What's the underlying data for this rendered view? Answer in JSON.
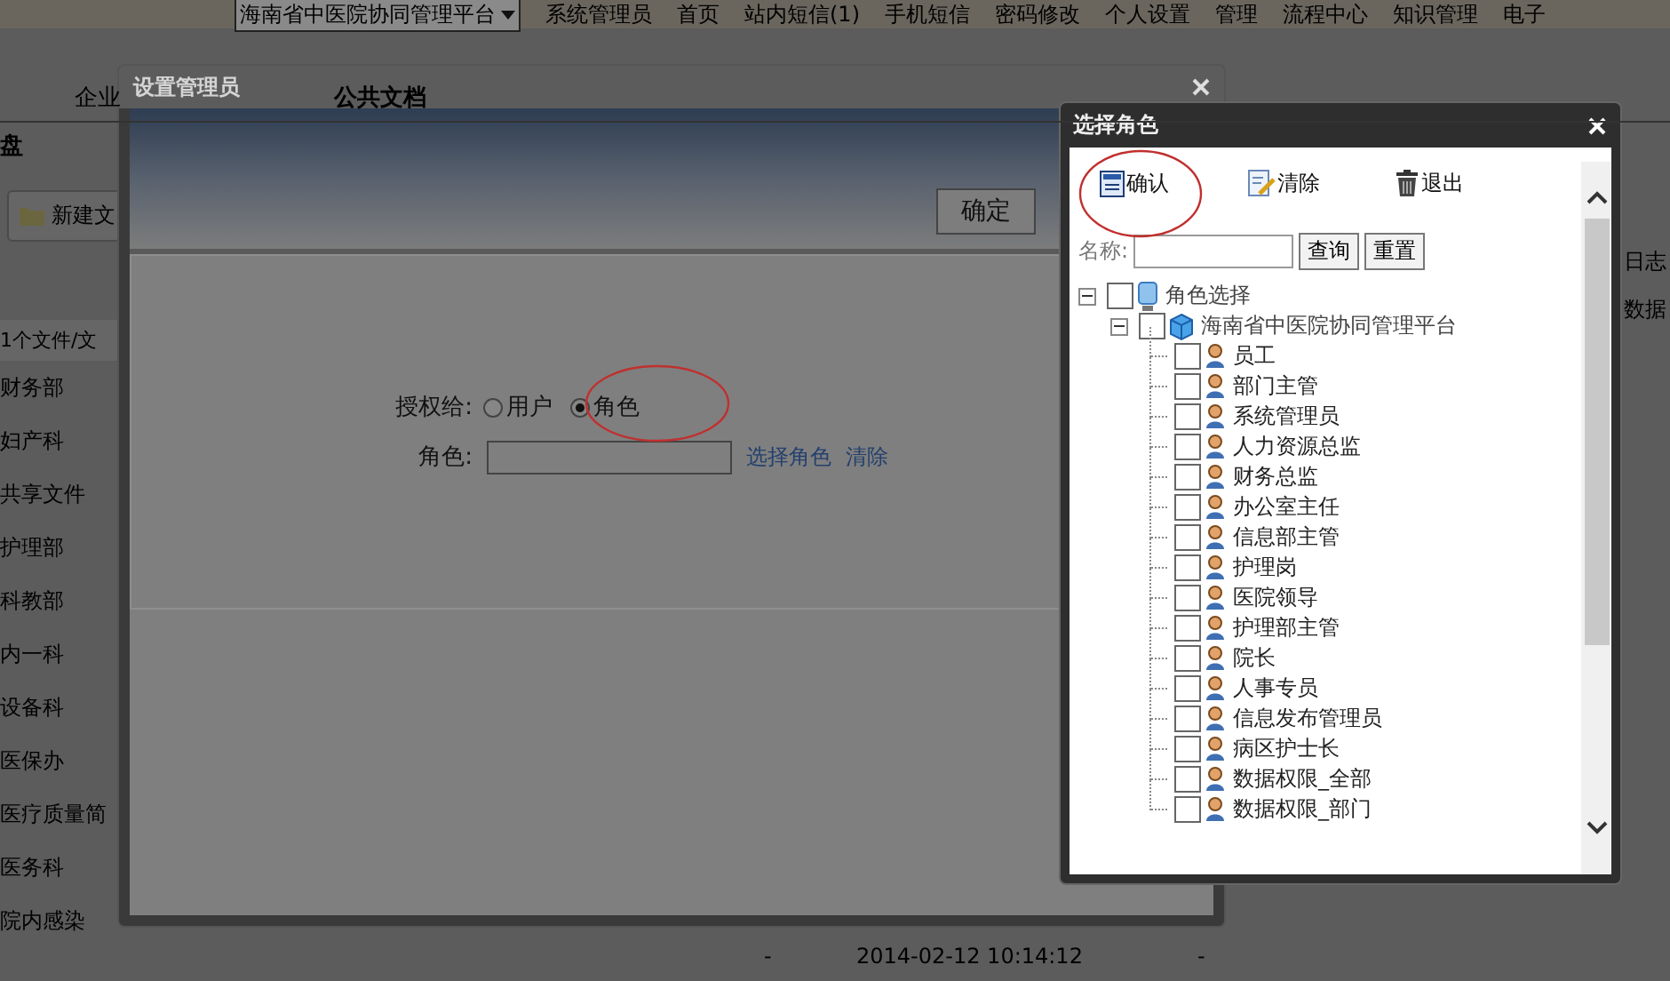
{
  "top_nav": {
    "org_select": "海南省中医院协同管理平台",
    "links": [
      "系统管理员",
      "首页",
      "站内短信(1)",
      "手机短信",
      "密码修改",
      "个人设置",
      "管理",
      "流程中心",
      "知识管理",
      "电子"
    ]
  },
  "tabs": [
    "企业",
    "公共文档"
  ],
  "left_panel": {
    "title": "盘",
    "new_button": "新建文",
    "count_text": "1个文件/文",
    "folders": [
      "财务部",
      "妇产科",
      "共享文件",
      "护理部",
      "科教部",
      "内一科",
      "设备科",
      "医保办",
      "医疗质量简",
      "医务科",
      "院内感染"
    ]
  },
  "right_column": [
    "日志",
    "数据"
  ],
  "bottom_row": [
    "-",
    "2014-02-12 10:14:12",
    "-"
  ],
  "admin_dialog": {
    "title": "设置管理员",
    "confirm_button": "确定",
    "grant_label": "授权给:",
    "grant_options": [
      {
        "label": "用户",
        "selected": false
      },
      {
        "label": "角色",
        "selected": true
      }
    ],
    "role_label": "角色:",
    "select_link": "选择角色",
    "clear_link": "清除"
  },
  "role_dialog": {
    "title": "选择角色",
    "toolbar": [
      {
        "kind": "confirm",
        "label": "确认"
      },
      {
        "kind": "clear",
        "label": "清除"
      },
      {
        "kind": "exit",
        "label": "退出"
      }
    ],
    "search_label": "名称:",
    "search_button": "查询",
    "reset_button": "重置",
    "tree": [
      {
        "label": "角色选择",
        "kind": "root",
        "expanded": true,
        "checked": false,
        "children": [
          {
            "label": "海南省中医院协同管理平台",
            "kind": "org",
            "expanded": true,
            "checked": false,
            "children": [
              {
                "label": "员工",
                "kind": "role",
                "checked": false
              },
              {
                "label": "部门主管",
                "kind": "role",
                "checked": false
              },
              {
                "label": "系统管理员",
                "kind": "role",
                "checked": false
              },
              {
                "label": "人力资源总监",
                "kind": "role",
                "checked": false
              },
              {
                "label": "财务总监",
                "kind": "role",
                "checked": false
              },
              {
                "label": "办公室主任",
                "kind": "role",
                "checked": false
              },
              {
                "label": "信息部主管",
                "kind": "role",
                "checked": false
              },
              {
                "label": "护理岗",
                "kind": "role",
                "checked": false
              },
              {
                "label": "医院领导",
                "kind": "role",
                "checked": false
              },
              {
                "label": "护理部主管",
                "kind": "role",
                "checked": false
              },
              {
                "label": "院长",
                "kind": "role",
                "checked": false
              },
              {
                "label": "人事专员",
                "kind": "role",
                "checked": false
              },
              {
                "label": "信息发布管理员",
                "kind": "role",
                "checked": false
              },
              {
                "label": "病区护士长",
                "kind": "role",
                "checked": false
              },
              {
                "label": "数据权限_全部",
                "kind": "role",
                "checked": false
              },
              {
                "label": "数据权限_部门",
                "kind": "role",
                "checked": false
              }
            ]
          }
        ]
      }
    ]
  }
}
